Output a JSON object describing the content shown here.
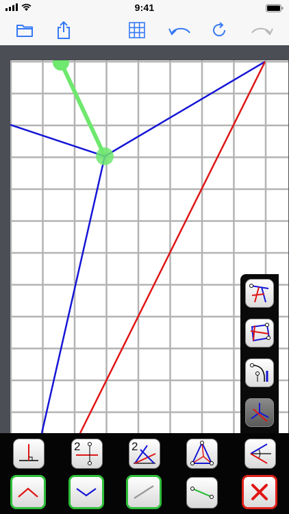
{
  "status_bar": {
    "time": "9:41",
    "icons": [
      "signal-icon",
      "wifi-icon",
      "battery-icon"
    ]
  },
  "toolbar": {
    "buttons": [
      {
        "name": "folder-icon",
        "enabled": true
      },
      {
        "name": "share-icon",
        "enabled": true
      },
      {
        "name": "grid-icon",
        "enabled": true
      },
      {
        "name": "undo-icon",
        "enabled": true
      },
      {
        "name": "rotate-icon",
        "enabled": true
      },
      {
        "name": "redo-icon",
        "enabled": false
      }
    ],
    "accent_color": "#3478f6",
    "disabled_color": "#b8b8b8"
  },
  "drawing": {
    "colors": {
      "blue": "#1515d6",
      "red": "#e01515",
      "green": "#6ee86e",
      "grid": "#b3b3b3"
    }
  },
  "side_palette": {
    "buttons": [
      {
        "name": "perpendicular-transform-icon",
        "active": false
      },
      {
        "name": "quadrilateral-transform-icon",
        "active": false
      },
      {
        "name": "arc-transform-icon",
        "active": false
      },
      {
        "name": "three-lines-icon",
        "active": true
      }
    ]
  },
  "bottom_tools": {
    "row1": [
      {
        "name": "perpendicular-tool-icon",
        "label": ""
      },
      {
        "name": "bisector-tool-icon",
        "label": "2"
      },
      {
        "name": "angle-bisector-tool-icon",
        "label": "2"
      },
      {
        "name": "triangle-tool-icon",
        "label": ""
      },
      {
        "name": "angle-tool-icon",
        "label": ""
      }
    ],
    "row2": [
      {
        "name": "red-angle-line-icon",
        "state": "green-border"
      },
      {
        "name": "blue-angle-line-icon",
        "state": "green-border"
      },
      {
        "name": "gray-line-icon",
        "state": "green-border"
      },
      {
        "name": "green-segment-icon",
        "state": "plain"
      },
      {
        "name": "delete-icon",
        "state": "red-border"
      }
    ]
  }
}
